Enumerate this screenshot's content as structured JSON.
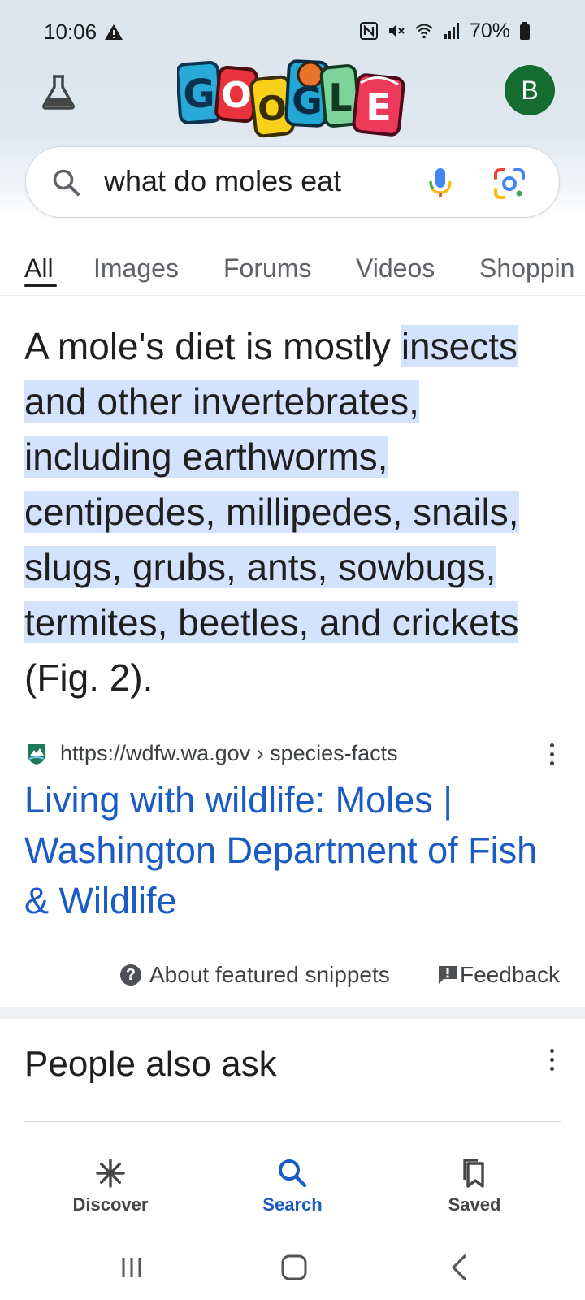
{
  "status_bar": {
    "time": "10:06",
    "battery": "70%"
  },
  "header": {
    "avatar_initial": "B",
    "avatar_color": "#146c2e",
    "doodle_letters": [
      "G",
      "O",
      "O",
      "G",
      "L",
      "E"
    ]
  },
  "search": {
    "query": "what do moles eat"
  },
  "tabs": [
    {
      "label": "All"
    },
    {
      "label": "Images"
    },
    {
      "label": "Forums"
    },
    {
      "label": "Videos"
    },
    {
      "label": "Shoppin"
    }
  ],
  "featured_snippet": {
    "text_before": "A mole's diet is mostly ",
    "text_highlight": "insects and other invertebrates, including earthworms, centipedes, millipedes, snails, slugs, grubs, ants, sowbugs, termites, beetles, and crickets",
    "text_after": " (Fig. 2).",
    "highlight_color": "#d3e3fd"
  },
  "source": {
    "url": "https://wdfw.wa.gov › species-facts",
    "title": "Living with wildlife: Moles | Washington Department of Fish & Wildlife",
    "title_color": "#1a5bc4"
  },
  "snippet_footer": {
    "about_label": "About featured snippets",
    "feedback_label": "Feedback"
  },
  "people_also_ask": {
    "title": "People also ask"
  },
  "bottom_nav": [
    {
      "label": "Discover",
      "icon": "asterisk-icon"
    },
    {
      "label": "Search",
      "icon": "search-icon"
    },
    {
      "label": "Saved",
      "icon": "bookmark-icon"
    }
  ]
}
